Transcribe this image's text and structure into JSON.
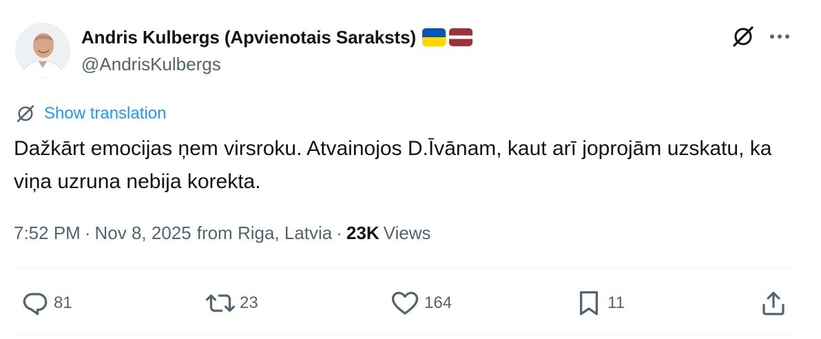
{
  "author": {
    "display_name": "Andris Kulbergs (Apvienotais Saraksts)",
    "handle": "@AndrisKulbergs",
    "avatar": "profile-photo",
    "flags": [
      "ukraine-flag",
      "latvia-flag"
    ]
  },
  "header_actions": {
    "grok_icon": "grok-icon",
    "more_icon": "more-dots-icon"
  },
  "translation": {
    "icon": "grok-icon",
    "link_label": "Show translation"
  },
  "tweet": {
    "text": "Dažkārt emocijas ņem virsroku. Atvainojos D.Īvānam, kaut arī joprojām uzskatu, ka viņa uzruna nebija korekta."
  },
  "meta": {
    "time": "7:52 PM",
    "separator1": "·",
    "date": "Nov 8, 2025",
    "location": "from Riga, Latvia",
    "separator2": "·",
    "views_count": "23K",
    "views_label": "Views"
  },
  "actions": {
    "reply": {
      "icon": "reply-icon",
      "count": "81"
    },
    "repost": {
      "icon": "repost-icon",
      "count": "23"
    },
    "like": {
      "icon": "heart-icon",
      "count": "164"
    },
    "bookmark": {
      "icon": "bookmark-icon",
      "count": "11"
    },
    "share": {
      "icon": "share-icon"
    }
  },
  "colors": {
    "text_primary": "#0f1419",
    "text_secondary": "#536471",
    "link": "#1d9bf0",
    "divider": "#eff3f4",
    "flag_ukraine_blue": "#0057b7",
    "flag_ukraine_yellow": "#ffd700",
    "flag_latvia_red": "#9e3039"
  }
}
